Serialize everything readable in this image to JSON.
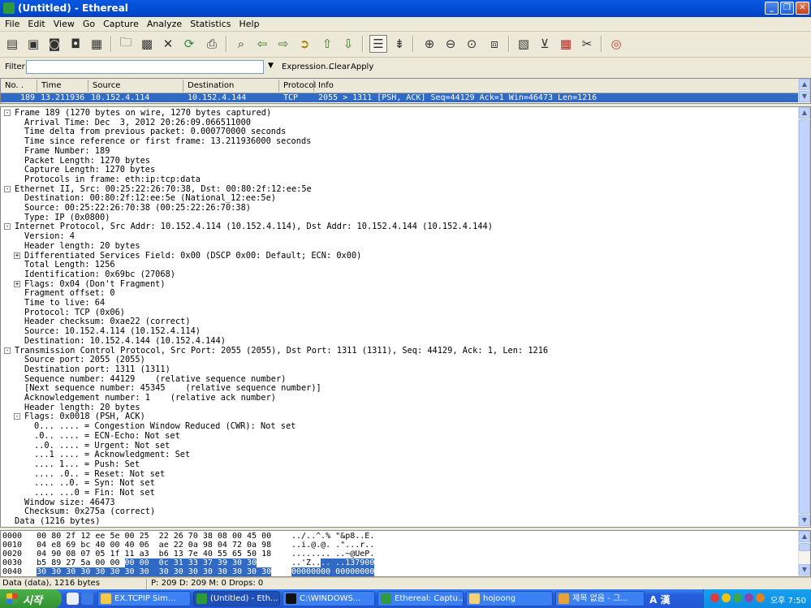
{
  "window": {
    "title": "(Untitled) - Ethereal"
  },
  "menu": [
    "File",
    "Edit",
    "View",
    "Go",
    "Capture",
    "Analyze",
    "Statistics",
    "Help"
  ],
  "filter": {
    "label": "Filter:",
    "value": "",
    "expression": "Expression...",
    "clear": "Clear",
    "apply": "Apply"
  },
  "packet_list": {
    "columns": [
      "No. .",
      "Time",
      "Source",
      "Destination",
      "Protocol",
      "Info"
    ],
    "rows": [
      {
        "no": "189",
        "time": "13.211936",
        "source": "10.152.4.114",
        "destination": "10.152.4.144",
        "protocol": "TCP",
        "info": "2055 > 1311 [PSH, ACK] Seq=44129 Ack=1 Win=46473 Len=1216"
      }
    ]
  },
  "details": [
    {
      "text": "Frame 189 (1270 bytes on wire, 1270 bytes captured)",
      "indent": 0,
      "exp": "-"
    },
    {
      "text": "Arrival Time: Dec  3, 2012 20:26:09.066511000",
      "indent": 1,
      "exp": ""
    },
    {
      "text": "Time delta from previous packet: 0.000770000 seconds",
      "indent": 1,
      "exp": ""
    },
    {
      "text": "Time since reference or first frame: 13.211936000 seconds",
      "indent": 1,
      "exp": ""
    },
    {
      "text": "Frame Number: 189",
      "indent": 1,
      "exp": ""
    },
    {
      "text": "Packet Length: 1270 bytes",
      "indent": 1,
      "exp": ""
    },
    {
      "text": "Capture Length: 1270 bytes",
      "indent": 1,
      "exp": ""
    },
    {
      "text": "Protocols in frame: eth:ip:tcp:data",
      "indent": 1,
      "exp": ""
    },
    {
      "text": "Ethernet II, Src: 00:25:22:26:70:38, Dst: 00:80:2f:12:ee:5e",
      "indent": 0,
      "exp": "-"
    },
    {
      "text": "Destination: 00:80:2f:12:ee:5e (National_12:ee:5e)",
      "indent": 1,
      "exp": ""
    },
    {
      "text": "Source: 00:25:22:26:70:38 (00:25:22:26:70:38)",
      "indent": 1,
      "exp": ""
    },
    {
      "text": "Type: IP (0x0800)",
      "indent": 1,
      "exp": ""
    },
    {
      "text": "Internet Protocol, Src Addr: 10.152.4.114 (10.152.4.114), Dst Addr: 10.152.4.144 (10.152.4.144)",
      "indent": 0,
      "exp": "-"
    },
    {
      "text": "Version: 4",
      "indent": 1,
      "exp": ""
    },
    {
      "text": "Header length: 20 bytes",
      "indent": 1,
      "exp": ""
    },
    {
      "text": "Differentiated Services Field: 0x00 (DSCP 0x00: Default; ECN: 0x00)",
      "indent": 1,
      "exp": "+"
    },
    {
      "text": "Total Length: 1256",
      "indent": 1,
      "exp": ""
    },
    {
      "text": "Identification: 0x69bc (27068)",
      "indent": 1,
      "exp": ""
    },
    {
      "text": "Flags: 0x04 (Don't Fragment)",
      "indent": 1,
      "exp": "+"
    },
    {
      "text": "Fragment offset: 0",
      "indent": 1,
      "exp": ""
    },
    {
      "text": "Time to live: 64",
      "indent": 1,
      "exp": ""
    },
    {
      "text": "Protocol: TCP (0x06)",
      "indent": 1,
      "exp": ""
    },
    {
      "text": "Header checksum: 0xae22 (correct)",
      "indent": 1,
      "exp": ""
    },
    {
      "text": "Source: 10.152.4.114 (10.152.4.114)",
      "indent": 1,
      "exp": ""
    },
    {
      "text": "Destination: 10.152.4.144 (10.152.4.144)",
      "indent": 1,
      "exp": ""
    },
    {
      "text": "Transmission Control Protocol, Src Port: 2055 (2055), Dst Port: 1311 (1311), Seq: 44129, Ack: 1, Len: 1216",
      "indent": 0,
      "exp": "-"
    },
    {
      "text": "Source port: 2055 (2055)",
      "indent": 1,
      "exp": ""
    },
    {
      "text": "Destination port: 1311 (1311)",
      "indent": 1,
      "exp": ""
    },
    {
      "text": "Sequence number: 44129    (relative sequence number)",
      "indent": 1,
      "exp": ""
    },
    {
      "text": "[Next sequence number: 45345    (relative sequence number)]",
      "indent": 1,
      "exp": ""
    },
    {
      "text": "Acknowledgement number: 1    (relative ack number)",
      "indent": 1,
      "exp": ""
    },
    {
      "text": "Header length: 20 bytes",
      "indent": 1,
      "exp": ""
    },
    {
      "text": "Flags: 0x0018 (PSH, ACK)",
      "indent": 1,
      "exp": "-"
    },
    {
      "text": "0... .... = Congestion Window Reduced (CWR): Not set",
      "indent": 2,
      "exp": ""
    },
    {
      "text": ".0.. .... = ECN-Echo: Not set",
      "indent": 2,
      "exp": ""
    },
    {
      "text": "..0. .... = Urgent: Not set",
      "indent": 2,
      "exp": ""
    },
    {
      "text": "...1 .... = Acknowledgment: Set",
      "indent": 2,
      "exp": ""
    },
    {
      "text": ".... 1... = Push: Set",
      "indent": 2,
      "exp": ""
    },
    {
      "text": ".... .0.. = Reset: Not set",
      "indent": 2,
      "exp": ""
    },
    {
      "text": ".... ..0. = Syn: Not set",
      "indent": 2,
      "exp": ""
    },
    {
      "text": ".... ...0 = Fin: Not set",
      "indent": 2,
      "exp": ""
    },
    {
      "text": "Window size: 46473",
      "indent": 1,
      "exp": ""
    },
    {
      "text": "Checksum: 0x275a (correct)",
      "indent": 1,
      "exp": ""
    },
    {
      "text": "Data (1216 bytes)",
      "indent": 0,
      "exp": ""
    }
  ],
  "hex": [
    {
      "off": "0000",
      "pre": "00 80 2f 12 ee 5e 00 25  22 26 70 38 08 00 45 00",
      "sel": "",
      "ascii_pre": "../..^.% \"&p8..E.",
      "ascii_sel": ""
    },
    {
      "off": "0010",
      "pre": "04 e8 69 bc 40 00 40 06  ae 22 0a 98 04 72 0a 98",
      "sel": "",
      "ascii_pre": "..i.@.@. .\"...r..",
      "ascii_sel": ""
    },
    {
      "off": "0020",
      "pre": "04 90 08 07 05 1f 11 a3  b6 13 7e 40 55 65 50 18",
      "sel": "",
      "ascii_pre": "........ ..~@UeP.",
      "ascii_sel": ""
    },
    {
      "off": "0030",
      "pre": "b5 89 27 5a 00 00 ",
      "sel": "00 00  0c 31 33 37 39 30 30",
      "ascii_pre": "..'Z..",
      "ascii_sel": ".. ..137900"
    },
    {
      "off": "0040",
      "pre": "",
      "sel": "30 30 30 30 30 30 30 30  30 30 30 30 30 30 30 30",
      "ascii_pre": "",
      "ascii_sel": "00000000 00000000"
    }
  ],
  "status": {
    "left": "Data (data), 1216 bytes",
    "right": "P: 209 D: 209 M: 0 Drops: 0"
  },
  "taskbar": {
    "start": "시작",
    "tasks": [
      "EX.TCPIP Sim...",
      "(Untitled) - Eth...",
      "C:\\WINDOWS...",
      "Ethereal: Captu...",
      "hojoong",
      "제목 없음 - 그..."
    ],
    "ime": "A 漢",
    "clock": "오후 7:50"
  }
}
